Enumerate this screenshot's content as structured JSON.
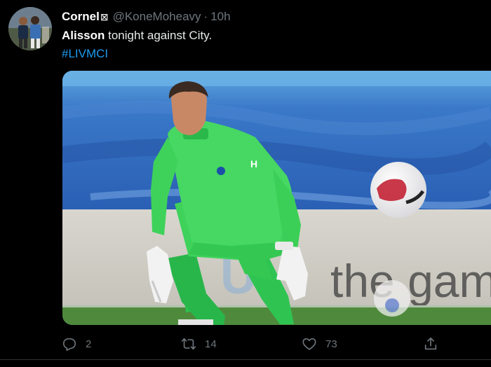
{
  "tweet": {
    "author": {
      "name": "Cornel",
      "name_icon": "⊠",
      "handle": "@KoneMoheavy",
      "separator": "·",
      "time": "10h"
    },
    "text": {
      "mention": "Alisson",
      "rest": " tonight against City."
    },
    "hashtag": "#LIVMCI",
    "actions": {
      "reply": {
        "icon": "reply-icon",
        "count": "2"
      },
      "retweet": {
        "icon": "retweet-icon",
        "count": "14"
      },
      "like": {
        "icon": "heart-icon",
        "count": "73"
      },
      "share": {
        "icon": "share-icon"
      }
    },
    "media_banner_text": "the game"
  },
  "colors": {
    "background": "#000000",
    "link": "#1d9bf0",
    "muted": "#6e767d",
    "kit_green": "#3fd25a"
  }
}
